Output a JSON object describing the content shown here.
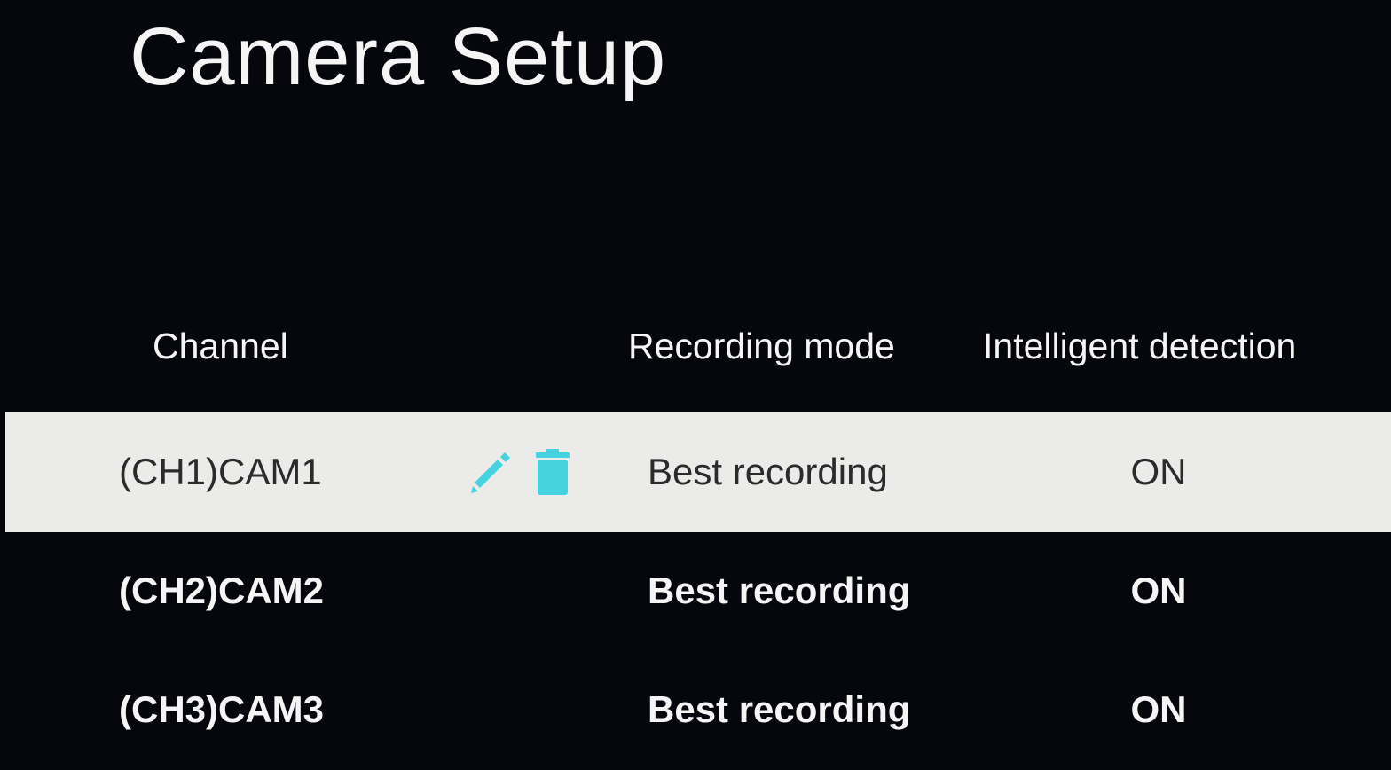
{
  "page": {
    "title": "Camera Setup"
  },
  "table": {
    "headers": {
      "channel": "Channel",
      "recording_mode": "Recording mode",
      "intelligent_detection": "Intelligent detection"
    },
    "rows": [
      {
        "channel": "(CH1)CAM1",
        "recording_mode": "Best recording",
        "intelligent_detection": "ON",
        "selected": true
      },
      {
        "channel": "(CH2)CAM2",
        "recording_mode": "Best recording",
        "intelligent_detection": "ON",
        "selected": false
      },
      {
        "channel": "(CH3)CAM3",
        "recording_mode": "Best recording",
        "intelligent_detection": "ON",
        "selected": false
      }
    ]
  },
  "icons": {
    "edit": "pencil-icon",
    "delete": "trash-icon"
  },
  "colors": {
    "background": "#05070d",
    "text": "#f5f5f5",
    "selected_row_background": "#ebebe9",
    "selected_row_text": "#2b2b2b",
    "accent_icon": "#45d4df"
  }
}
